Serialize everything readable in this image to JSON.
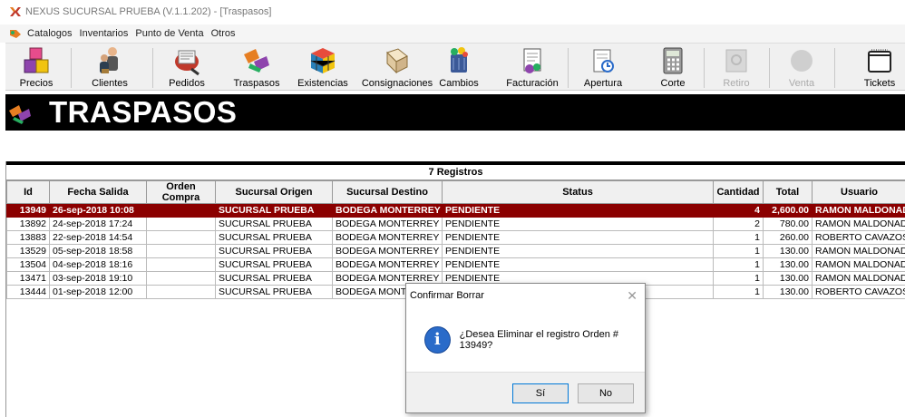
{
  "window": {
    "title": "NEXUS SUCURSAL PRUEBA (V.1.1.202) - [Traspasos]"
  },
  "menu": {
    "items": [
      "Catalogos",
      "Inventarios",
      "Punto de Venta",
      "Otros"
    ]
  },
  "toolbar": {
    "buttons": [
      {
        "label": "Precios",
        "icon": "price-blocks-icon",
        "enabled": true
      },
      {
        "label": "Clientes",
        "icon": "customers-icon",
        "enabled": true
      },
      {
        "label": "Pedidos",
        "icon": "orders-icon",
        "enabled": true
      },
      {
        "label": "Traspasos",
        "icon": "transfers-icon",
        "enabled": true
      },
      {
        "label": "Existencias",
        "icon": "stock-cube-icon",
        "enabled": true
      },
      {
        "label": "Consignaciones",
        "icon": "consignment-icon",
        "enabled": true
      },
      {
        "label": "Cambios",
        "icon": "recycle-bin-icon",
        "enabled": true
      },
      {
        "label": "Facturación",
        "icon": "invoice-icon",
        "enabled": true
      },
      {
        "label": "Apertura",
        "icon": "open-register-icon",
        "enabled": true
      },
      {
        "label": "Corte",
        "icon": "calculator-icon",
        "enabled": true
      },
      {
        "label": "Retiro",
        "icon": "safe-icon",
        "enabled": false
      },
      {
        "label": "Venta",
        "icon": "sale-circle-icon",
        "enabled": false
      },
      {
        "label": "Tickets",
        "icon": "receipt-icon",
        "enabled": true
      }
    ]
  },
  "page": {
    "title": "TRASPASOS"
  },
  "grid": {
    "record_count": "7 Registros",
    "columns": [
      "Id",
      "Fecha Salida",
      "Orden Compra",
      "Sucursal Origen",
      "Sucursal Destino",
      "Status",
      "Cantidad",
      "Total",
      "Usuario"
    ],
    "rows": [
      [
        "13949",
        "26-sep-2018 10:08",
        "",
        "SUCURSAL PRUEBA",
        "BODEGA MONTERREY",
        "PENDIENTE",
        "4",
        "2,600.00",
        "RAMON MALDONADO"
      ],
      [
        "13892",
        "24-sep-2018 17:24",
        "",
        "SUCURSAL PRUEBA",
        "BODEGA MONTERREY",
        "PENDIENTE",
        "2",
        "780.00",
        "RAMON MALDONADO"
      ],
      [
        "13883",
        "22-sep-2018 14:54",
        "",
        "SUCURSAL PRUEBA",
        "BODEGA MONTERREY",
        "PENDIENTE",
        "1",
        "260.00",
        "ROBERTO CAVAZOS"
      ],
      [
        "13529",
        "05-sep-2018 18:58",
        "",
        "SUCURSAL PRUEBA",
        "BODEGA MONTERREY",
        "PENDIENTE",
        "1",
        "130.00",
        "RAMON MALDONADO"
      ],
      [
        "13504",
        "04-sep-2018 18:16",
        "",
        "SUCURSAL PRUEBA",
        "BODEGA MONTERREY",
        "PENDIENTE",
        "1",
        "130.00",
        "RAMON MALDONADO"
      ],
      [
        "13471",
        "03-sep-2018 19:10",
        "",
        "SUCURSAL PRUEBA",
        "BODEGA MONTERREY",
        "PENDIENTE",
        "1",
        "130.00",
        "RAMON MALDONADO"
      ],
      [
        "13444",
        "01-sep-2018 12:00",
        "",
        "SUCURSAL PRUEBA",
        "BODEGA MONTERREY",
        "",
        "1",
        "130.00",
        "ROBERTO CAVAZOS"
      ]
    ],
    "selected_row": 0
  },
  "dialog": {
    "title": "Confirmar Borrar",
    "message": "¿Desea Eliminar el registro Orden # 13949?",
    "yes_label": "Sí",
    "no_label": "No"
  },
  "colors": {
    "selected_row": "#8b0000",
    "header_bar": "#000000",
    "info_icon": "#2a6bc9"
  }
}
